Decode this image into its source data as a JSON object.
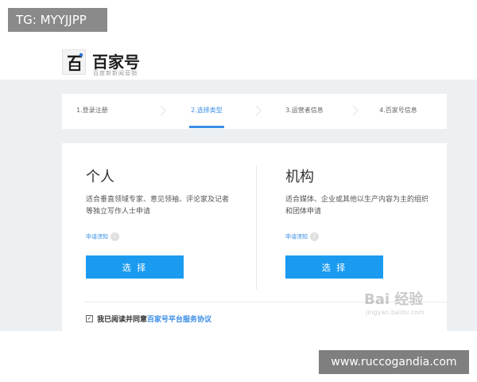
{
  "overlay": {
    "top_tag": "TG: MYYJJPP",
    "bottom_tag": "www.ruccogandia.com"
  },
  "header": {
    "logo_name": "百家号",
    "logo_slogan": "百度新新闻营销",
    "logo_icon": "baijiahao-logo-icon"
  },
  "steps": [
    {
      "label": "1.登录注册",
      "active": false
    },
    {
      "label": "2.选择类型",
      "active": true
    },
    {
      "label": "3.运营者信息",
      "active": false
    },
    {
      "label": "4.百家号信息",
      "active": false
    }
  ],
  "options": {
    "personal": {
      "title": "个人",
      "desc": "适合垂直领域专家、意见领袖、评论家及记者等独立写作人士申请",
      "note": "申请须知",
      "button": "选 择"
    },
    "org": {
      "title": "机构",
      "desc": "适合媒体、企业或其他以生产内容为主的组织和团体申请",
      "note": "申请须知",
      "button": "选 择"
    }
  },
  "agreement": {
    "checked": true,
    "text": "我已阅读并同意",
    "link": "百家号平台服务协议"
  },
  "watermark": {
    "line1": "Bai 经验",
    "line2": "jingyan.baidu.com"
  },
  "colors": {
    "accent": "#3a8ee6",
    "button": "#1a9bf0",
    "band": "#edf0f3"
  }
}
